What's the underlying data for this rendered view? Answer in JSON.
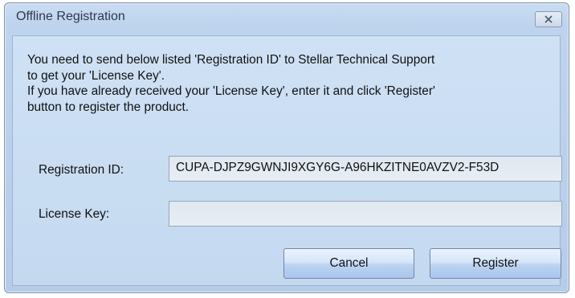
{
  "window": {
    "title": "Offline Registration",
    "close_icon": "close-icon"
  },
  "message": {
    "lines": [
      "You need to send below listed 'Registration ID' to Stellar Technical Support",
      "to get your 'License Key'.",
      "If you have already received your 'License Key', enter it and click 'Register'",
      "button to register the product."
    ]
  },
  "form": {
    "registration_id_label": "Registration ID:",
    "registration_id_value": "CUPA-DJPZ9GWNJI9XGY6G-A96HKZITNE0AVZV2-F53D",
    "license_key_label": "License Key:",
    "license_key_value": ""
  },
  "buttons": {
    "cancel_label": "Cancel",
    "register_label": "Register"
  }
}
